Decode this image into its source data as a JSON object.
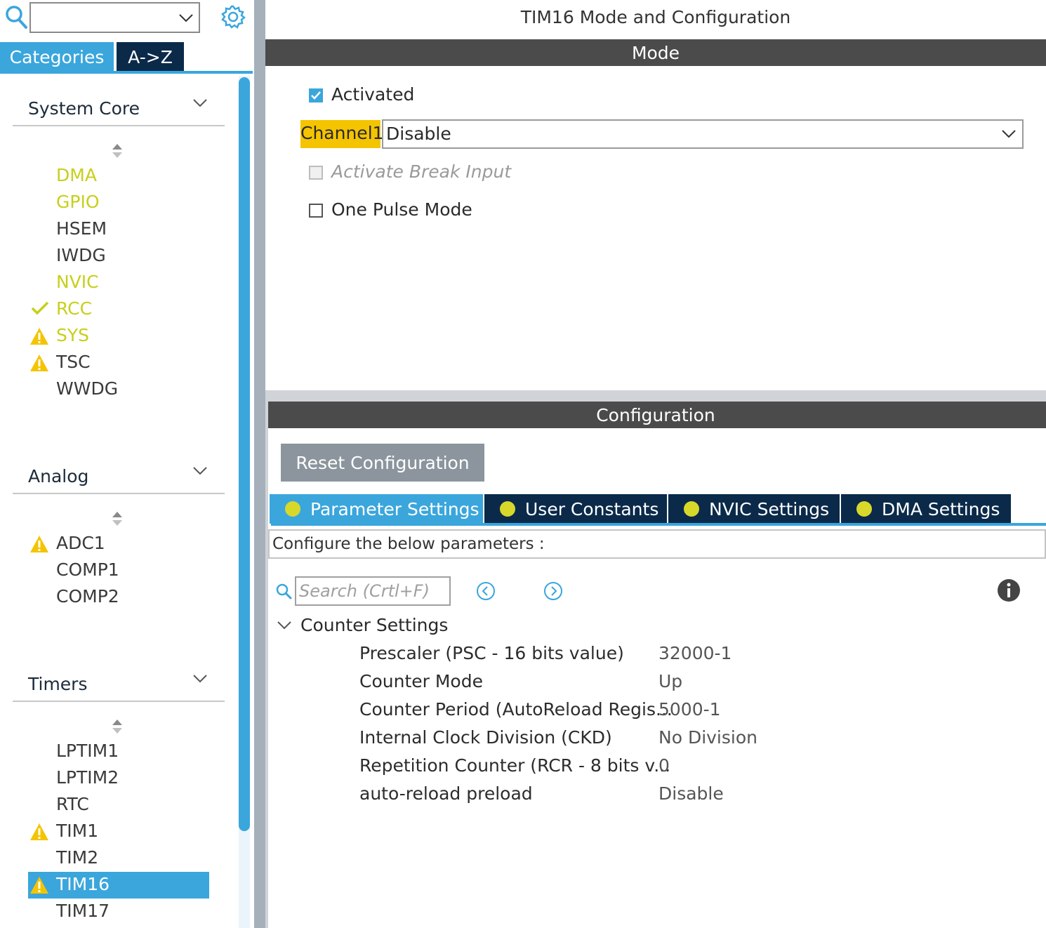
{
  "left": {
    "search": {
      "value": "",
      "placeholder": ""
    },
    "tabs": {
      "categories": "Categories",
      "az": "A->Z"
    },
    "groups": [
      {
        "title": "System Core"
      },
      {
        "title": "Analog"
      },
      {
        "title": "Timers"
      }
    ],
    "system_core_items": [
      "DMA",
      "GPIO",
      "HSEM",
      "IWDG",
      "NVIC",
      "RCC",
      "SYS",
      "TSC",
      "WWDG"
    ],
    "analog_items": [
      "ADC1",
      "COMP1",
      "COMP2"
    ],
    "timers_items": [
      "LPTIM1",
      "LPTIM2",
      "RTC",
      "TIM1",
      "TIM2",
      "TIM16",
      "TIM17"
    ]
  },
  "right": {
    "title": "TIM16 Mode and Configuration",
    "mode_bar": "Mode",
    "activated_label": "Activated",
    "channel1_label": "Channel1",
    "channel1_value": "Disable",
    "break_input_label": "Activate Break Input",
    "one_pulse_label": "One Pulse Mode",
    "config_bar": "Configuration",
    "reset_button": "Reset Configuration",
    "tabs": [
      "Parameter Settings",
      "User Constants",
      "NVIC Settings",
      "DMA Settings"
    ],
    "configure_text": "Configure the below parameters :",
    "search_placeholder": "Search (Crtl+F)",
    "section_title": "Counter Settings",
    "params": [
      {
        "name": "Prescaler (PSC - 16 bits value)",
        "value": "32000-1"
      },
      {
        "name": "Counter Mode",
        "value": "Up"
      },
      {
        "name": "Counter Period (AutoReload Regis...",
        "value": "5000-1"
      },
      {
        "name": "Internal Clock Division (CKD)",
        "value": "No Division"
      },
      {
        "name": "Repetition Counter (RCR - 8 bits v...",
        "value": "0"
      },
      {
        "name": "auto-reload preload",
        "value": "Disable"
      }
    ]
  },
  "colors": {
    "accent": "#3aa6dc",
    "dark_tab": "#0b2a4a",
    "bar": "#4b4b4b",
    "enabled_item": "#c8cf1a",
    "warning": "#f5c400",
    "channel_highlight": "#f5c400"
  }
}
